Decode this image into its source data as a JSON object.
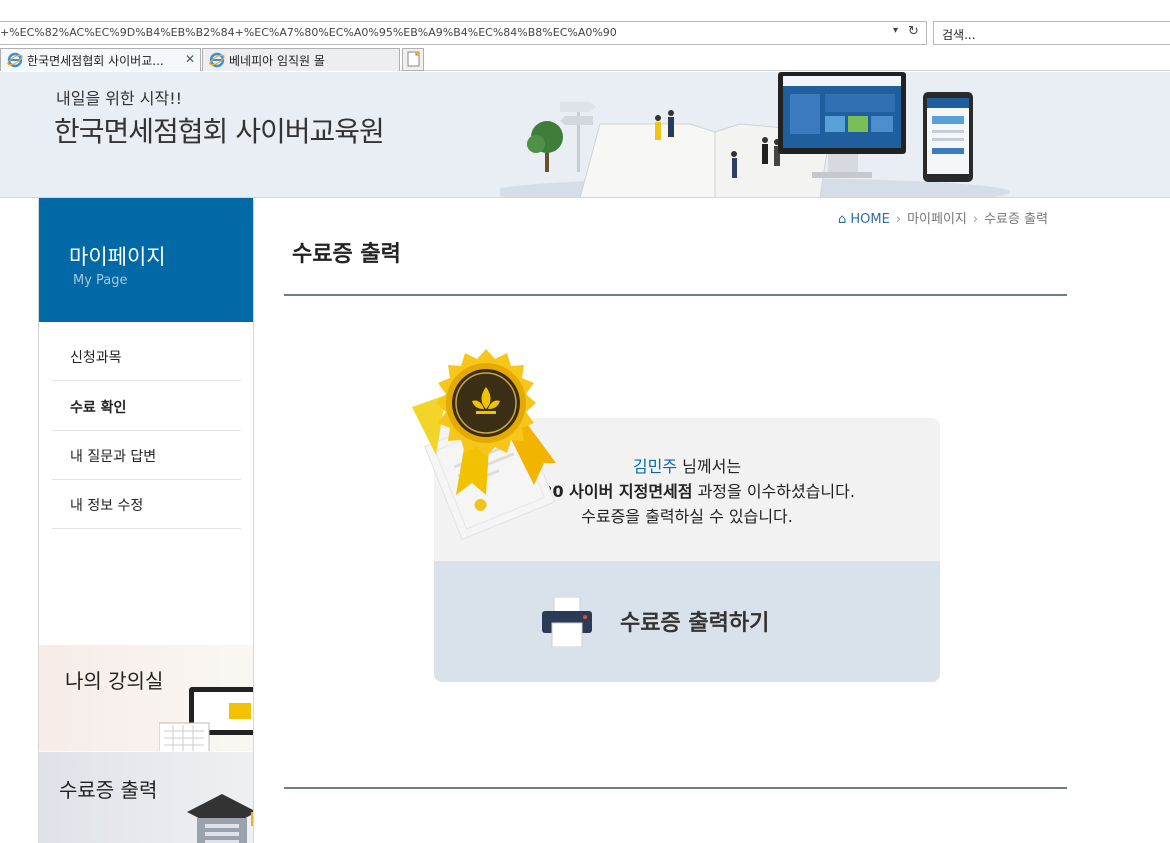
{
  "browser": {
    "url": "+%EC%82%AC%EC%9D%B4%EB%B2%84+%EC%A7%80%EC%A0%95%EB%A9%B4%EC%84%B8%EC%A0%90",
    "search_placeholder": "검색...",
    "tabs": [
      {
        "label": "한국면세점협회 사이버교...",
        "active": true
      },
      {
        "label": "베네피아 임직원 몰",
        "active": false
      }
    ]
  },
  "banner": {
    "subtitle": "내일을 위한 시작!!",
    "title": "한국면세점협회 사이버교육원"
  },
  "sidebar": {
    "title": "마이페이지",
    "subtitle": "My Page",
    "items": [
      {
        "label": "신청과목",
        "bold": false
      },
      {
        "label": "수료 확인",
        "bold": true
      },
      {
        "label": "내 질문과 답변",
        "bold": false
      },
      {
        "label": "내 정보 수정",
        "bold": false
      }
    ],
    "cards": [
      {
        "label": "나의 강의실"
      },
      {
        "label": "수료증 출력"
      }
    ]
  },
  "breadcrumb": {
    "home": "HOME",
    "level1": "마이페이지",
    "level2": "수료증 출력"
  },
  "page": {
    "title": "수료증 출력"
  },
  "certificate": {
    "name": "김민주",
    "line1_suffix": " 님께서는",
    "course": "2020 사이버 지정면세점",
    "line2_suffix": " 과정을 이수하셨습니다.",
    "line3": "수료증을 출력하실 수 있습니다.",
    "print_label": "수료증 출력하기"
  },
  "colors": {
    "accent": "#0069a6",
    "name_color": "#0b6aa8",
    "print_bg": "#d9e2ea"
  }
}
